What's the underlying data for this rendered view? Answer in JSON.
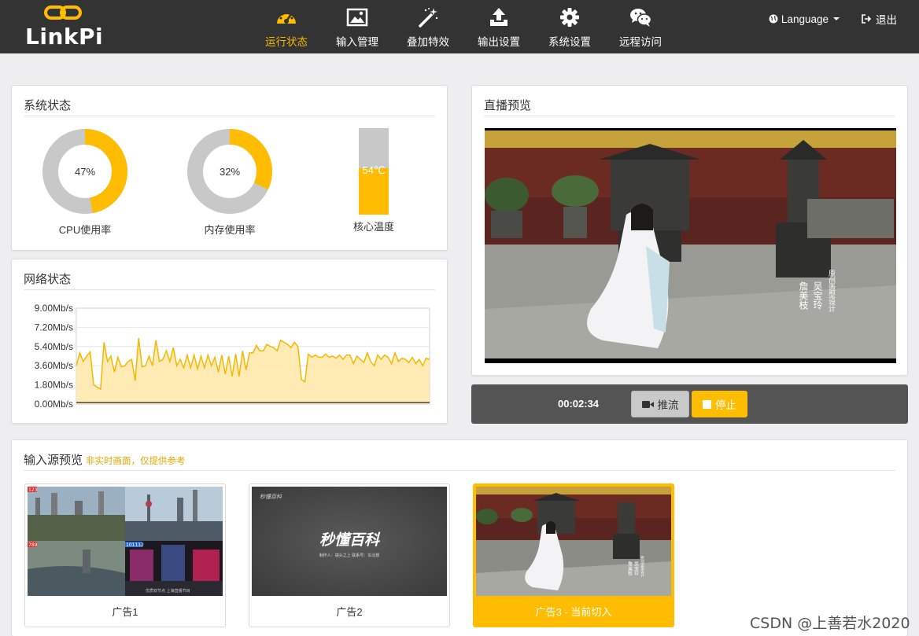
{
  "logo": {
    "text": "LinkPi"
  },
  "nav": {
    "items": [
      {
        "label": "运行状态",
        "icon": "dashboard-icon",
        "active": true
      },
      {
        "label": "输入管理",
        "icon": "image-icon",
        "active": false
      },
      {
        "label": "叠加特效",
        "icon": "magic-wand-icon",
        "active": false
      },
      {
        "label": "输出设置",
        "icon": "upload-icon",
        "active": false
      },
      {
        "label": "系统设置",
        "icon": "gear-icon",
        "active": false
      },
      {
        "label": "远程访问",
        "icon": "wechat-icon",
        "active": false
      }
    ],
    "language": "Language",
    "logout": "退出"
  },
  "system_status": {
    "title": "系统状态",
    "cpu": {
      "percent": 47,
      "label": "47%",
      "caption": "CPU使用率"
    },
    "memory": {
      "percent": 32,
      "label": "32%",
      "caption": "内存使用率"
    },
    "temperature": {
      "value": 54,
      "label": "54℃",
      "caption": "核心温度"
    }
  },
  "network": {
    "title": "网络状态",
    "chart_data": {
      "type": "area",
      "title": "",
      "xlabel": "",
      "ylabel": "",
      "y_ticks": [
        "9.00Mb/s",
        "7.20Mb/s",
        "5.40Mb/s",
        "3.60Mb/s",
        "1.80Mb/s",
        "0.00Mb/s"
      ],
      "ylim": [
        0,
        9
      ],
      "series": [
        {
          "values": [
            3.6,
            4.8,
            4.0,
            4.5,
            4.9,
            1.8,
            1.6,
            1.4,
            5.8,
            4.0,
            4.5,
            3.0,
            4.4,
            3.5,
            3.6,
            4.0,
            4.2,
            2.2,
            6.2,
            3.5,
            3.6,
            4.5,
            3.6,
            6.0,
            4.0,
            4.2,
            5.0,
            4.0,
            5.3,
            3.6,
            4.2,
            3.4,
            4.6,
            3.4,
            4.6,
            3.3,
            4.5,
            3.4,
            4.6,
            3.6,
            4.4,
            3.0,
            4.6,
            2.8,
            4.5,
            2.6,
            4.7,
            2.6,
            5.0,
            3.2,
            4.8,
            4.8,
            5.5,
            5.0,
            5.0,
            5.6,
            5.4,
            5.3,
            5.0,
            6.0,
            5.8,
            5.6,
            5.3,
            5.8,
            5.4,
            2.3,
            2.1,
            4.7,
            4.4,
            4.6,
            4.4,
            4.4,
            4.7,
            4.4,
            4.5,
            4.3,
            4.6,
            4.2,
            4.6,
            4.6,
            3.8,
            4.5,
            4.2,
            3.9,
            4.8,
            4.0,
            3.6,
            4.6,
            4.2,
            4.6,
            4.4,
            3.8,
            4.8,
            4.0,
            4.3,
            4.2,
            3.9,
            4.4,
            3.8,
            4.2,
            3.6,
            4.3,
            4.2
          ]
        },
        {
          "values": [
            0.15,
            0.15,
            0.15,
            0.15,
            0.15,
            0.15,
            0.15,
            0.15,
            0.15,
            0.15,
            0.15,
            0.15
          ]
        }
      ]
    }
  },
  "live_preview": {
    "title": "直播预览"
  },
  "controls": {
    "timer": "00:02:34",
    "push_label": "推流",
    "stop_label": "停止"
  },
  "input_preview": {
    "title": "输入源预览",
    "note": "非实时画面，仅提供参考",
    "items": [
      {
        "label": "广告1",
        "active": false,
        "badges": [
          "123",
          "789",
          "101112"
        ],
        "caption": "优质双节点 上海直播节目"
      },
      {
        "label": "广告2",
        "active": false,
        "brand": "秒懂百科",
        "caption": "制作人：镜头之上   联系号：东北楼"
      },
      {
        "label": "广告3 - 当前切入",
        "active": true
      }
    ]
  },
  "video_overlay": {
    "line1": "詹美枝",
    "line2": "吴宝玲",
    "line3": "原创造型设计"
  },
  "watermark": "CSDN @上善若水2020",
  "colors": {
    "accent": "#ffbc00",
    "topbar": "#333333",
    "background": "#eeeef0",
    "control_bar": "#545454"
  }
}
